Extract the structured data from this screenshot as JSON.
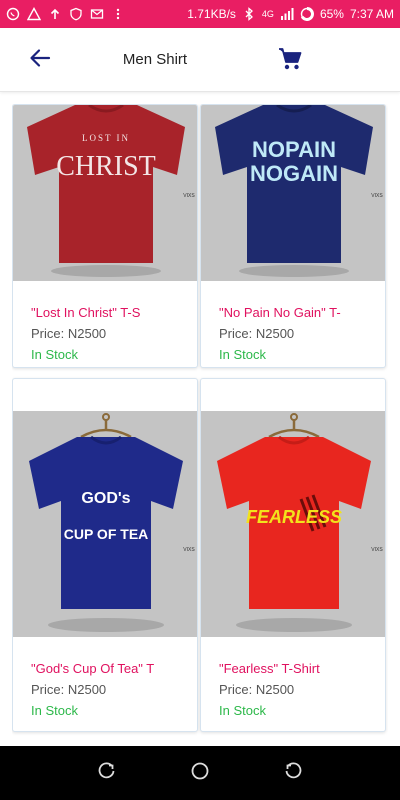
{
  "status_bar": {
    "speed": "1.71KB/s",
    "network": "4G",
    "battery": "65%",
    "time": "7:37 AM",
    "icons": [
      "whatsapp-icon",
      "warning-icon",
      "upload-icon",
      "shield-icon",
      "mail-icon",
      "more-dots-icon",
      "bluetooth-icon",
      "network-icon",
      "signal-icon",
      "battery-icon"
    ]
  },
  "header": {
    "title": "Men Shirt",
    "back_icon": "arrow-left-icon",
    "cart_icon": "cart-icon",
    "accent_color": "#1a237e"
  },
  "products": [
    {
      "name": "\"Lost In Christ\" T-S",
      "price": "Price: N2500",
      "stock": "In Stock",
      "shirt_color": "#a8232a",
      "print_line1": "LOST IN",
      "print_line2": "CHRIST"
    },
    {
      "name": "\"No Pain No Gain\" T-",
      "price": "Price: N2500",
      "stock": "In Stock",
      "shirt_color": "#1e2a6e",
      "print_line1": "NOPAIN",
      "print_line2": "NOGAIN"
    },
    {
      "name": "\"God's Cup Of Tea\" T",
      "price": "Price: N2500",
      "stock": "In Stock",
      "shirt_color": "#1f2a8a",
      "print_line1": "GOD's",
      "print_line2": "CUP OF TEA"
    },
    {
      "name": "\"Fearless\" T-Shirt",
      "price": "Price: N2500",
      "stock": "In Stock",
      "shirt_color": "#e8261f",
      "print_line1": "FEARLESS",
      "print_line2": ""
    }
  ],
  "colors": {
    "status_bar": "#e91e63",
    "product_name": "#e0115f",
    "in_stock": "#2db84a"
  },
  "nav": {
    "icons": [
      "recent-apps-icon",
      "home-icon",
      "back-icon"
    ]
  }
}
